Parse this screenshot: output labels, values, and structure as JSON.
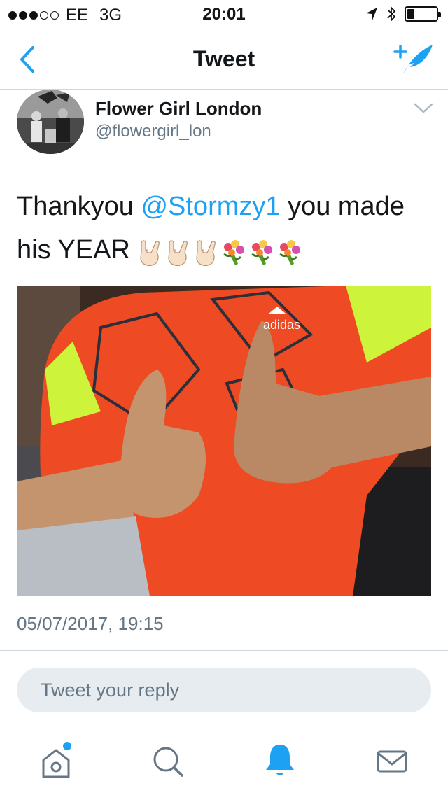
{
  "status_bar": {
    "carrier": "EE",
    "network": "3G",
    "time": "20:01",
    "signal_bars": 3,
    "signal_total": 5,
    "battery_level": 0.25
  },
  "nav": {
    "title": "Tweet",
    "back_icon": "chevron-left-icon",
    "compose_icon": "compose-tweet-icon",
    "accent_color": "#1da1f2"
  },
  "tweet": {
    "author_name": "Flower Girl London",
    "author_handle": "@flowergirl_lon",
    "text_before": "Thankyou ",
    "mention": "@Stormzy1",
    "text_after": " you made his YEAR ",
    "emojis": [
      "rock-on-hand-emoji",
      "rock-on-hand-emoji",
      "rock-on-hand-emoji",
      "bouquet-emoji",
      "bouquet-emoji",
      "bouquet-emoji"
    ],
    "timestamp": "05/07/2017, 19:15",
    "media_icon": "photo-boy-thumbs-up"
  },
  "reply": {
    "placeholder": "Tweet your reply"
  },
  "tabbar": {
    "items": [
      {
        "name": "home",
        "icon": "home-icon",
        "active": false,
        "has_badge": true
      },
      {
        "name": "search",
        "icon": "search-icon",
        "active": false
      },
      {
        "name": "notifications",
        "icon": "bell-icon",
        "active": true
      },
      {
        "name": "messages",
        "icon": "envelope-icon",
        "active": false
      }
    ]
  }
}
